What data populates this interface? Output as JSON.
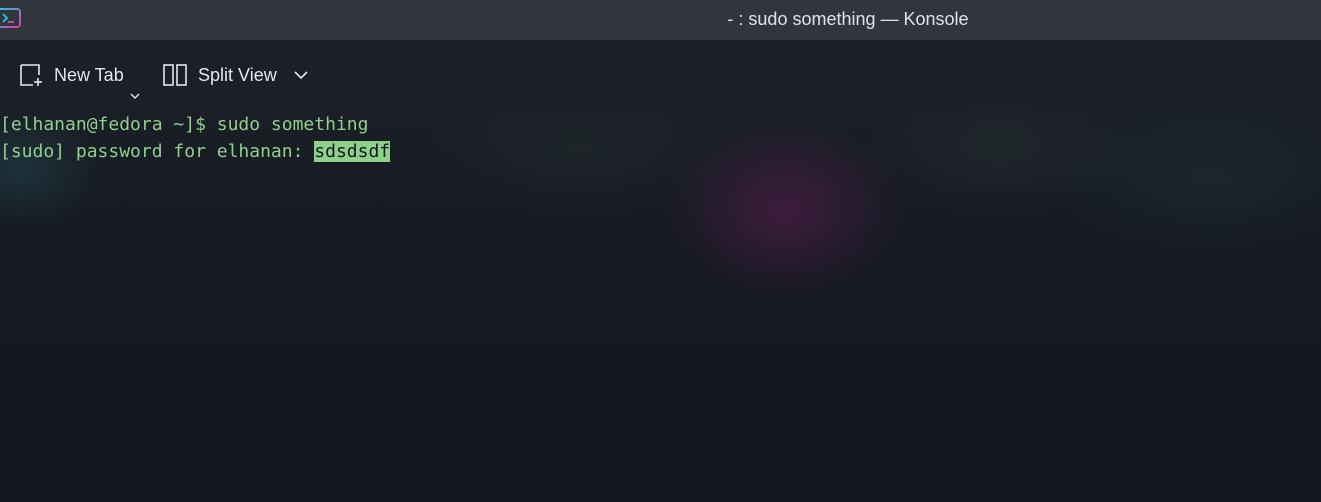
{
  "window": {
    "title": "- : sudo something — Konsole",
    "app_icon": "konsole-icon"
  },
  "toolbar": {
    "new_tab_label": "New Tab",
    "new_tab_icon": "new-tab-icon",
    "split_view_label": "Split View",
    "split_view_icon": "split-view-icon"
  },
  "terminal": {
    "line1": "[elhanan@fedora ~]$ sudo something",
    "line2_prompt": "[sudo] password for elhanan: ",
    "line2_input": "sdsdsdf"
  },
  "colors": {
    "titlebar_bg": "#31363d",
    "toolbar_bg": "#1b1f27",
    "terminal_bg": "#141822",
    "terminal_text": "#8fd08a",
    "accent": "#3daee9"
  }
}
